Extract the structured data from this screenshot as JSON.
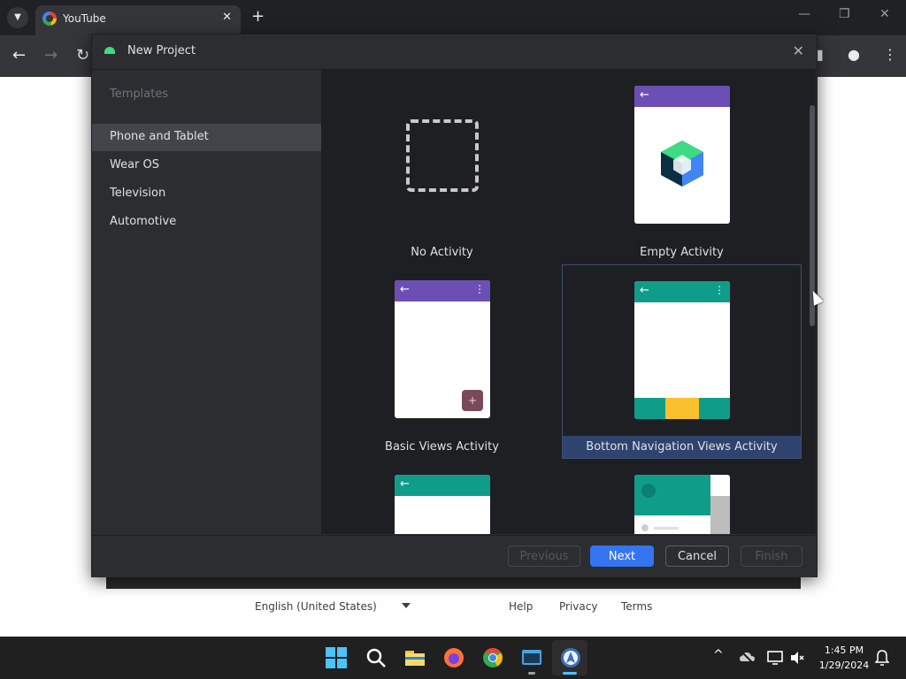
{
  "browser": {
    "tab_title": "YouTube",
    "tab_close": "✕",
    "new_tab": "+",
    "win_minimize": "—",
    "win_restore": "❐",
    "win_close": "✕",
    "back": "←",
    "forward": "→",
    "reload": "↻"
  },
  "page_footer": {
    "language": "English (United States)",
    "help": "Help",
    "privacy": "Privacy",
    "terms": "Terms"
  },
  "dialog": {
    "title": "New Project",
    "close": "✕",
    "sidebar": {
      "header": "Templates",
      "items": [
        {
          "label": "Phone and Tablet",
          "selected": true
        },
        {
          "label": "Wear OS",
          "selected": false
        },
        {
          "label": "Television",
          "selected": false
        },
        {
          "label": "Automotive",
          "selected": false
        }
      ]
    },
    "templates": [
      {
        "label": "No Activity"
      },
      {
        "label": "Empty Activity"
      },
      {
        "label": "Basic Views Activity"
      },
      {
        "label": "Bottom Navigation Views Activity",
        "selected": true
      }
    ],
    "glyphs": {
      "back_arrow": "←",
      "menu_dots": "⋮",
      "fab_plus": "+"
    },
    "buttons": {
      "previous": "Previous",
      "next": "Next",
      "cancel": "Cancel",
      "finish": "Finish"
    }
  },
  "taskbar": {
    "time": "1:45 PM",
    "date": "1/29/2024",
    "tray_chevron": "^"
  },
  "colors": {
    "purple_appbar": "#6c4fb5",
    "teal_appbar": "#0f9d8a",
    "accent_blue": "#3574f0",
    "selection_blue": "#2e436e"
  }
}
